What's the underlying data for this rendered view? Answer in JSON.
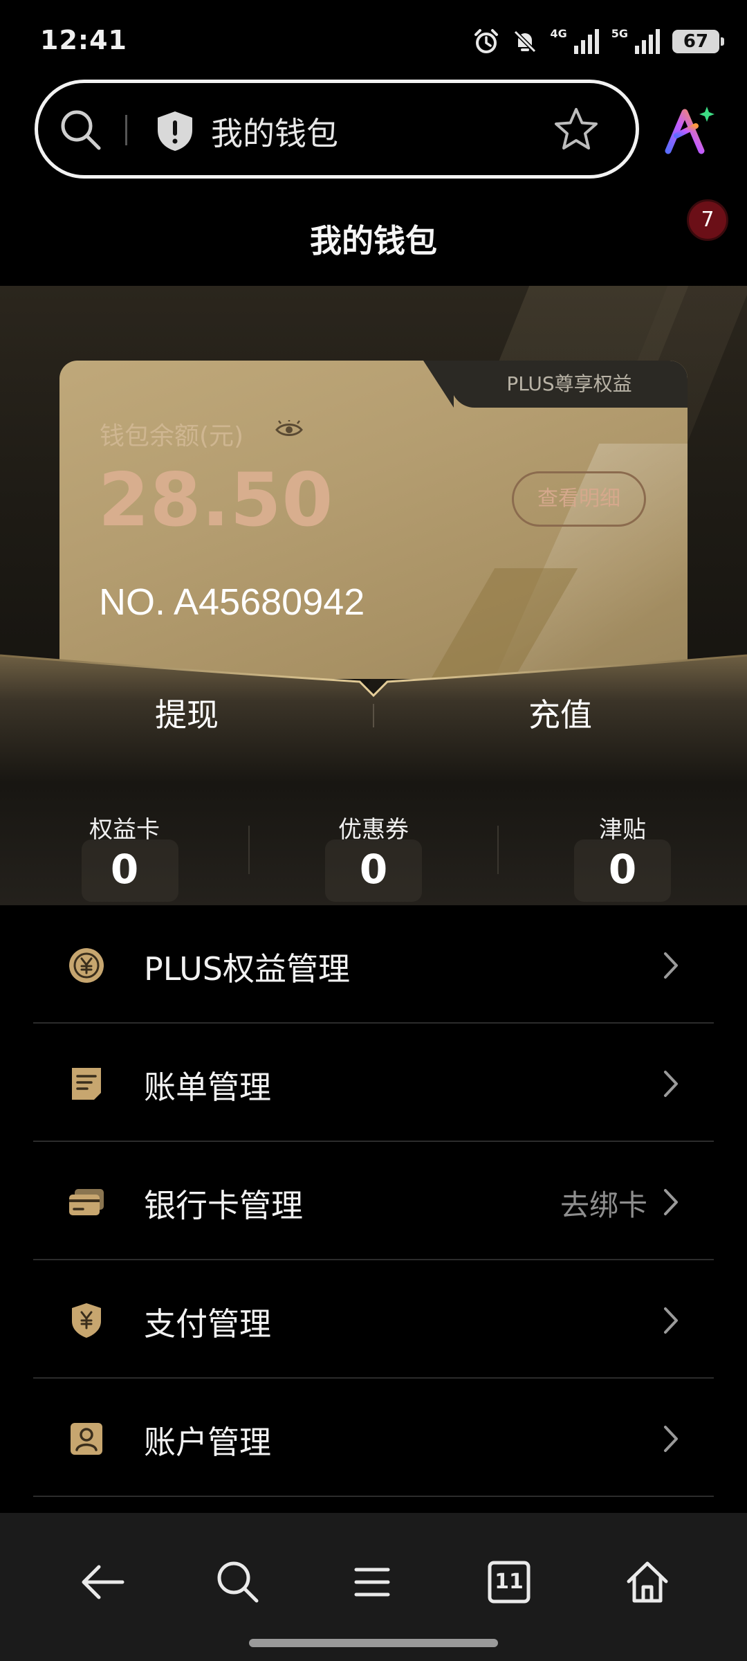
{
  "status_bar": {
    "time": "12:41",
    "network_1": "4G",
    "network_2": "5G",
    "battery": "67"
  },
  "search": {
    "text": "我的钱包"
  },
  "header": {
    "title": "我的钱包",
    "badge_count": "7"
  },
  "wallet_card": {
    "tab_label": "PLUS尊享权益",
    "balance_label": "钱包余额(元)",
    "balance": "28.50",
    "detail_button": "查看明细",
    "card_number": "NO. A45680942"
  },
  "actions": {
    "withdraw": "提现",
    "recharge": "充值"
  },
  "stats": [
    {
      "label": "权益卡",
      "value": "0"
    },
    {
      "label": "优惠券",
      "value": "0"
    },
    {
      "label": "津贴",
      "value": "0"
    }
  ],
  "menu": [
    {
      "label": "PLUS权益管理",
      "extra": "",
      "icon": "coin-icon"
    },
    {
      "label": "账单管理",
      "extra": "",
      "icon": "bill-icon"
    },
    {
      "label": "银行卡管理",
      "extra": "去绑卡",
      "icon": "bank-card-icon"
    },
    {
      "label": "支付管理",
      "extra": "",
      "icon": "payment-shield-icon"
    },
    {
      "label": "账户管理",
      "extra": "",
      "icon": "account-icon"
    }
  ],
  "bottom_nav": {
    "tab_count": "11"
  },
  "colors": {
    "accent_gold": "#bfa87a",
    "badge_red": "#6b0f17",
    "balance_text": "#d8ae8e"
  }
}
